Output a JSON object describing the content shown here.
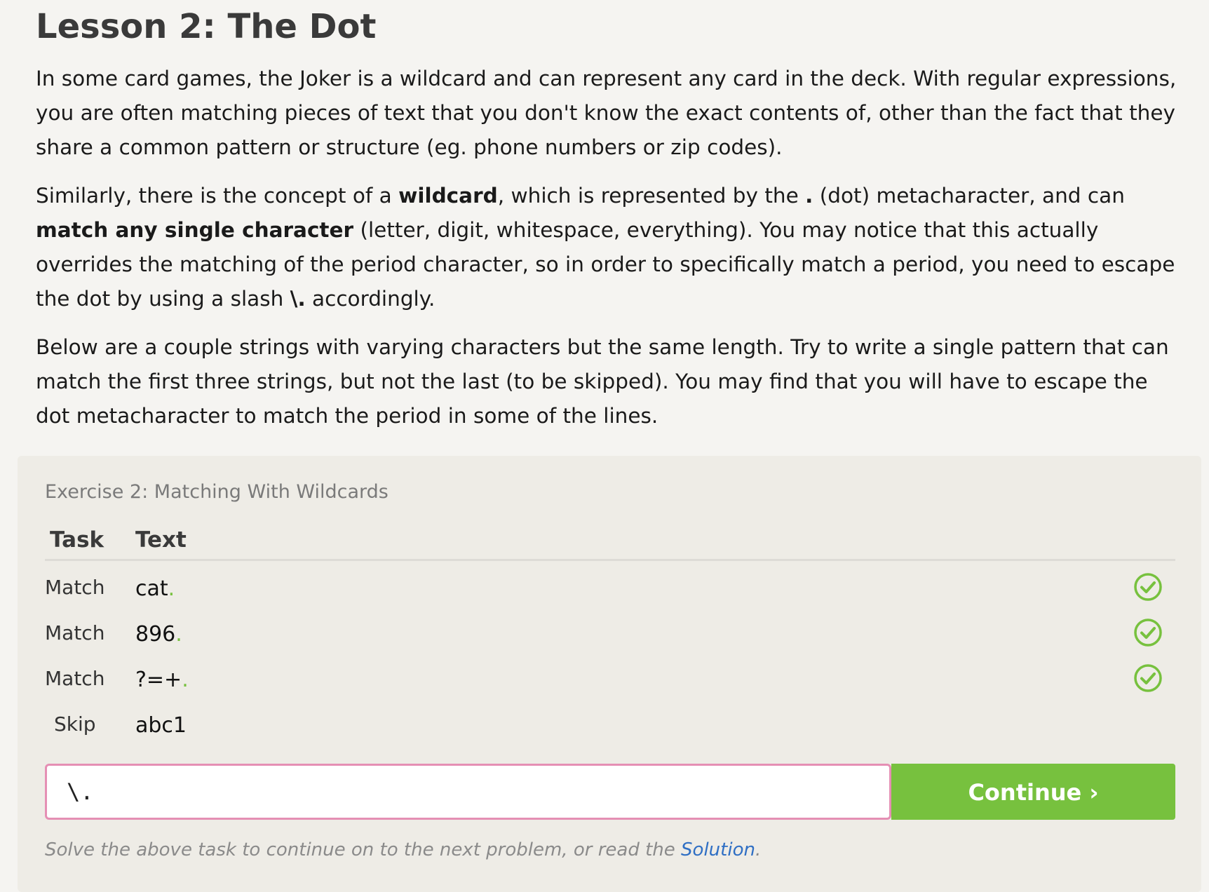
{
  "lesson": {
    "title": "Lesson 2: The Dot",
    "paragraphs": {
      "p1": "In some card games, the Joker is a wildcard and can represent any card in the deck. With regular expressions, you are often matching pieces of text that you don't know the exact contents of, other than the fact that they share a common pattern or structure (eg. phone numbers or zip codes).",
      "p2_a": "Similarly, there is the concept of a ",
      "p2_b": "wildcard",
      "p2_c": ", which is represented by the ",
      "p2_d": ".",
      "p2_e": " (dot) metacharacter, and can ",
      "p2_f": "match any single character",
      "p2_g": " (letter, digit, whitespace, everything). You may notice that this actually overrides the matching of the period character, so in order to specifically match a period, you need to escape the dot by using a slash ",
      "p2_h": "\\.",
      "p2_i": " accordingly.",
      "p3": "Below are a couple strings with varying characters but the same length. Try to write a single pattern that can match the first three strings, but not the last (to be skipped). You may find that you will have to escape the dot metacharacter to match the period in some of the lines."
    }
  },
  "exercise": {
    "title": "Exercise 2: Matching With Wildcards",
    "headers": {
      "task": "Task",
      "text": "Text"
    },
    "rows": [
      {
        "task": "Match",
        "text_main": "cat",
        "text_match": ".",
        "status": "matched"
      },
      {
        "task": "Match",
        "text_main": "896",
        "text_match": ".",
        "status": "matched"
      },
      {
        "task": "Match",
        "text_main": "?=+",
        "text_match": ".",
        "status": "matched"
      },
      {
        "task": "Skip",
        "text_main": "abc1",
        "text_match": "",
        "status": "none"
      }
    ],
    "input_value": "\\.",
    "continue_label": "Continue ›",
    "hint_prefix": "Solve the above task to continue on to the next problem, or read the ",
    "hint_link": "Solution",
    "hint_suffix": "."
  },
  "colors": {
    "accent_green": "#77c13e",
    "input_border": "#e58fb4",
    "link_blue": "#2f6fc4",
    "panel_bg": "#eeece6",
    "page_bg": "#f5f4f1"
  },
  "icons": {
    "row_status": "check-circle-icon"
  }
}
